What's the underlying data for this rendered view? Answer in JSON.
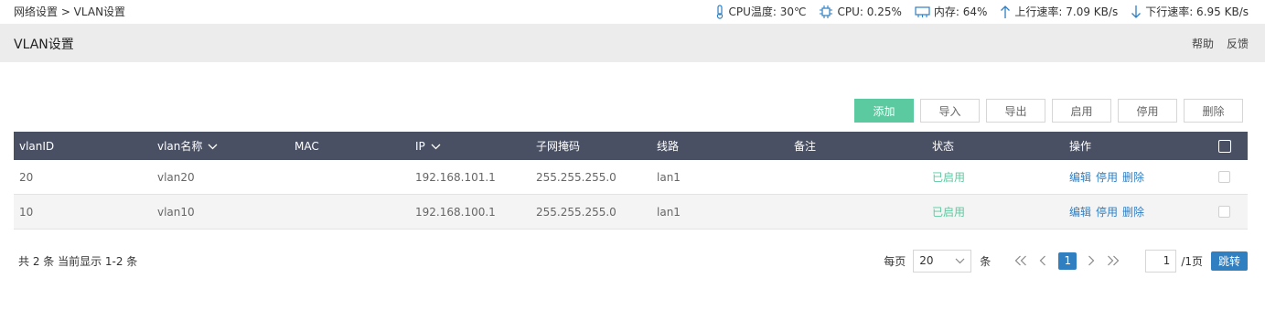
{
  "breadcrumb": "网络设置 > VLAN设置",
  "stats": {
    "cpu_temp": "CPU温度: 30℃",
    "cpu": "CPU: 0.25%",
    "memory": "内存: 64%",
    "upload": "上行速率: 7.09 KB/s",
    "download": "下行速率: 6.95 KB/s"
  },
  "title": "VLAN设置",
  "title_links": {
    "help": "帮助",
    "feedback": "反馈"
  },
  "toolbar": {
    "add": "添加",
    "import": "导入",
    "export": "导出",
    "enable": "启用",
    "disable": "停用",
    "delete": "删除"
  },
  "table": {
    "headers": {
      "vlan_id": "vlanID",
      "vlan_name": "vlan名称",
      "mac": "MAC",
      "ip": "IP",
      "mask": "子网掩码",
      "line": "线路",
      "note": "备注",
      "status": "状态",
      "ops": "操作"
    },
    "rows": [
      {
        "vlan_id": "20",
        "vlan_name": "vlan20",
        "mac": "",
        "ip": "192.168.101.1",
        "mask": "255.255.255.0",
        "line": "lan1",
        "note": "",
        "status": "已启用",
        "op_edit": "编辑",
        "op_disable": "停用",
        "op_delete": "删除"
      },
      {
        "vlan_id": "10",
        "vlan_name": "vlan10",
        "mac": "",
        "ip": "192.168.100.1",
        "mask": "255.255.255.0",
        "line": "lan1",
        "note": "",
        "status": "已启用",
        "op_edit": "编辑",
        "op_disable": "停用",
        "op_delete": "删除"
      }
    ]
  },
  "summary": "共 2 条 当前显示 1-2 条",
  "pager": {
    "per_page_label": "每页",
    "per_page_value": "20",
    "per_page_unit": "条",
    "current_page": "1",
    "page_input": "1",
    "total_pages": "/1页",
    "jump": "跳转"
  },
  "colors": {
    "header_bg": "#4a5064",
    "accent_green": "#5bcaa0",
    "link_blue": "#2f7fc1",
    "title_bar_bg": "#ececec"
  },
  "icons": {
    "cpu_temp": "thermometer-icon",
    "cpu": "chip-icon",
    "memory": "memory-icon",
    "upload": "arrow-up-icon",
    "download": "arrow-down-icon"
  }
}
